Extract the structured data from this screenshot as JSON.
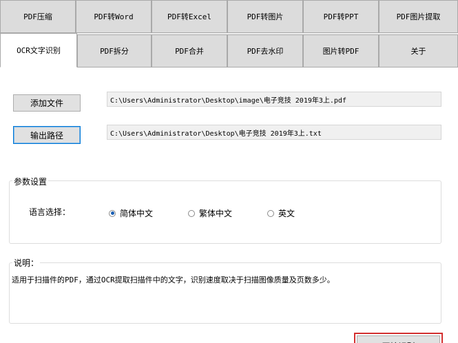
{
  "tabs_row1": [
    "PDF压缩",
    "PDF转Word",
    "PDF转Excel",
    "PDF转图片",
    "PDF转PPT",
    "PDF图片提取"
  ],
  "tabs_row2": [
    "OCR文字识别",
    "PDF拆分",
    "PDF合并",
    "PDF去水印",
    "图片转PDF",
    "关于"
  ],
  "add_file_label": "添加文件",
  "add_file_path": "C:\\Users\\Administrator\\Desktop\\image\\电子竞技 2019年3上.pdf",
  "output_label": "输出路径",
  "output_path": "C:\\Users\\Administrator\\Desktop\\电子竞技 2019年3上.txt",
  "params": {
    "title": "参数设置",
    "lang_label": "语言选择：",
    "options": [
      "简体中文",
      "繁体中文",
      "英文"
    ],
    "selected": "简体中文"
  },
  "desc": {
    "title": "说明：",
    "text": "适用于扫描件的PDF，通过OCR提取扫描件中的文字，识别速度取决于扫描图像质量及页数多少。"
  },
  "start_label": "开始识别"
}
